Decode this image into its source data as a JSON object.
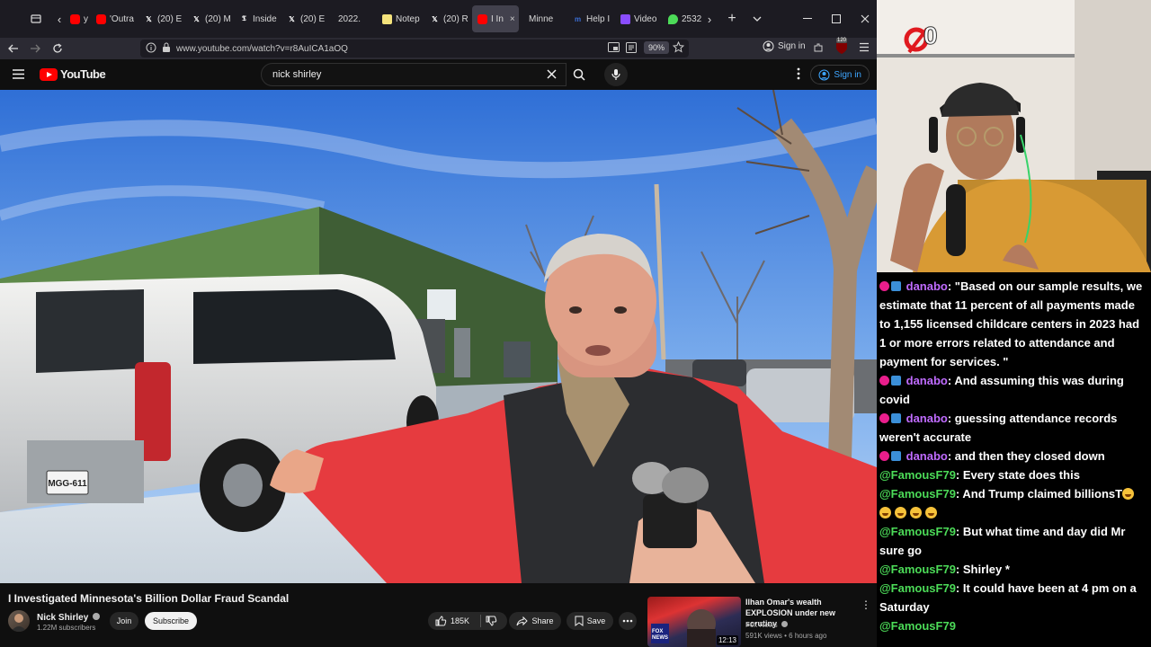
{
  "browser": {
    "tabs": [
      {
        "label": "y",
        "favicon": "youtube-icon",
        "color": "#ff0000"
      },
      {
        "label": "'Outra",
        "favicon": "youtube-icon",
        "color": "#ff0000"
      },
      {
        "label": "(20) E",
        "favicon": "x-icon",
        "color": "#ffffff"
      },
      {
        "label": "(20) M",
        "favicon": "x-icon",
        "color": "#ffffff"
      },
      {
        "label": "Inside",
        "favicon": "nyt-icon",
        "color": "#ffffff"
      },
      {
        "label": "(20) E",
        "favicon": "x-icon",
        "color": "#ffffff"
      },
      {
        "label": "2022.",
        "favicon": "blank-icon",
        "color": "#888888"
      },
      {
        "label": "Notep",
        "favicon": "notepad-icon",
        "color": "#f4e37c"
      },
      {
        "label": "(20) R",
        "favicon": "x-icon",
        "color": "#ffffff"
      },
      {
        "label": "I In",
        "favicon": "youtube-icon",
        "color": "#ff0000",
        "active": true
      },
      {
        "label": "Minne",
        "favicon": "blank-icon",
        "color": "#888888"
      },
      {
        "label": "Help I",
        "favicon": "m-icon",
        "color": "#3b6fd8"
      },
      {
        "label": "Video",
        "favicon": "pen-icon",
        "color": "#8a4dff"
      },
      {
        "label": "2532",
        "favicon": "maps-icon",
        "color": "#4cdb58"
      }
    ],
    "url": "www.youtube.com/watch?v=r8AuICA1aOQ",
    "zoom": "90%",
    "signin_label": "Sign in",
    "badge_count": "120"
  },
  "youtube": {
    "logo_text": "YouTube",
    "search_value": "nick shirley",
    "signin_label": "Sign in",
    "video_title": "I Investigated Minnesota's Billion Dollar Fraud Scandal",
    "channel_name": "Nick Shirley",
    "subscribers": "1.22M subscribers",
    "join_label": "Join",
    "subscribe_label": "Subscribe",
    "likes": "185K",
    "share_label": "Share",
    "save_label": "Save",
    "van_plate": "MGG-611",
    "recommended": {
      "title": "Ilhan Omar's wealth EXPLOSION under new scrutiny",
      "channel": "Fox News",
      "meta": "591K views • 6 hours ago",
      "duration": "12:13",
      "thumb_label": "FOX NEWS"
    }
  },
  "stream": {
    "counter": "0",
    "chat": [
      {
        "user": "danabo",
        "type": "d",
        "text": ": \"Based on our sample results, we estimate that 11 percent of all payments made to 1,155 licensed childcare centers in 2023 had 1 or more errors related to attendance and payment for services. \""
      },
      {
        "user": "danabo",
        "type": "d",
        "text": ": And assuming this was during covid"
      },
      {
        "user": "danabo",
        "type": "d",
        "text": ": guessing attendance records weren't accurate"
      },
      {
        "user": "danabo",
        "type": "d",
        "text": ": and then they closed down"
      },
      {
        "user": "@FamousF79",
        "type": "f",
        "text": ": Every state does this"
      },
      {
        "user": "@FamousF79",
        "type": "f",
        "text": ": And Trump claimed billionsT",
        "emoji": 5
      },
      {
        "user": "@FamousF79",
        "type": "f",
        "text": ": But what time and day did Mr sure go"
      },
      {
        "user": "@FamousF79",
        "type": "f",
        "text": ": Shirley *"
      },
      {
        "user": "@FamousF79",
        "type": "f",
        "text": ": It could have been at 4 pm on a Saturday"
      },
      {
        "user": "@FamousF79",
        "type": "f",
        "text": ""
      }
    ]
  }
}
